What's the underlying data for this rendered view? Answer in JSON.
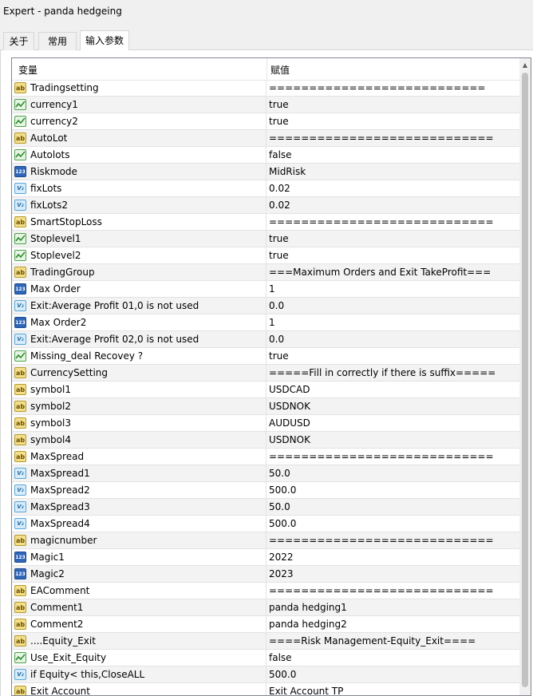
{
  "window": {
    "title": "Expert - panda hedgeing"
  },
  "tabs": [
    {
      "label": "关于",
      "active": false
    },
    {
      "label": "常用",
      "active": false
    },
    {
      "label": "输入参数",
      "active": true
    }
  ],
  "grid": {
    "columns": {
      "variable": "变量",
      "value": "赋值"
    },
    "rows": [
      {
        "icon": "ab",
        "name": "Tradingsetting",
        "value": "==========================="
      },
      {
        "icon": "bool",
        "name": "currency1",
        "value": "true"
      },
      {
        "icon": "bool",
        "name": "currency2",
        "value": "true"
      },
      {
        "icon": "ab",
        "name": "AutoLot",
        "value": "============================"
      },
      {
        "icon": "bool",
        "name": "Autolots",
        "value": "false"
      },
      {
        "icon": "int",
        "name": "Riskmode",
        "value": "MidRisk"
      },
      {
        "icon": "dbl",
        "name": "fixLots",
        "value": "0.02"
      },
      {
        "icon": "dbl",
        "name": "fixLots2",
        "value": "0.02"
      },
      {
        "icon": "ab",
        "name": "SmartStopLoss",
        "value": "============================"
      },
      {
        "icon": "bool",
        "name": "Stoplevel1",
        "value": "true"
      },
      {
        "icon": "bool",
        "name": "Stoplevel2",
        "value": "true"
      },
      {
        "icon": "ab",
        "name": "TradingGroup",
        "value": "===Maximum Orders and Exit TakeProfit==="
      },
      {
        "icon": "int",
        "name": "Max Order",
        "value": "1"
      },
      {
        "icon": "dbl",
        "name": "Exit:Average Profit 01,0 is not used",
        "value": "0.0"
      },
      {
        "icon": "int",
        "name": "Max Order2",
        "value": "1"
      },
      {
        "icon": "dbl",
        "name": "Exit:Average Profit 02,0 is not used",
        "value": "0.0"
      },
      {
        "icon": "bool",
        "name": "Missing_deal Recovey ?",
        "value": "true"
      },
      {
        "icon": "ab",
        "name": "CurrencySetting",
        "value": "=====Fill in correctly if there is suffix====="
      },
      {
        "icon": "ab",
        "name": "symbol1",
        "value": "USDCAD"
      },
      {
        "icon": "ab",
        "name": "symbol2",
        "value": "USDNOK"
      },
      {
        "icon": "ab",
        "name": "symbol3",
        "value": "AUDUSD"
      },
      {
        "icon": "ab",
        "name": "symbol4",
        "value": "USDNOK"
      },
      {
        "icon": "ab",
        "name": "MaxSpread",
        "value": "============================"
      },
      {
        "icon": "dbl",
        "name": "MaxSpread1",
        "value": "50.0"
      },
      {
        "icon": "dbl",
        "name": "MaxSpread2",
        "value": "500.0"
      },
      {
        "icon": "dbl",
        "name": "MaxSpread3",
        "value": "50.0"
      },
      {
        "icon": "dbl",
        "name": "MaxSpread4",
        "value": "500.0"
      },
      {
        "icon": "ab",
        "name": "magicnumber",
        "value": "============================"
      },
      {
        "icon": "int",
        "name": "Magic1",
        "value": "2022"
      },
      {
        "icon": "int",
        "name": "Magic2",
        "value": "2023"
      },
      {
        "icon": "ab",
        "name": "EAComment",
        "value": "============================"
      },
      {
        "icon": "ab",
        "name": "Comment1",
        "value": "panda hedging1"
      },
      {
        "icon": "ab",
        "name": "Comment2",
        "value": "panda hedging2"
      },
      {
        "icon": "ab",
        "name": "....Equity_Exit",
        "value": "====Risk Management-Equity_Exit===="
      },
      {
        "icon": "bool",
        "name": "Use_Exit_Equity",
        "value": "false"
      },
      {
        "icon": "dbl",
        "name": "if Equity< this,CloseALL",
        "value": "500.0"
      },
      {
        "icon": "ab",
        "name": "Exit Account",
        "value": "Exit Account TP"
      }
    ]
  },
  "icons": {
    "ab": {
      "text": "ab",
      "semantic": "string-type-icon"
    },
    "bool": {
      "text": "",
      "semantic": "bool-type-icon"
    },
    "int": {
      "text": "123",
      "semantic": "integer-type-icon"
    },
    "dbl": {
      "text": "V₂",
      "semantic": "double-type-icon"
    }
  }
}
